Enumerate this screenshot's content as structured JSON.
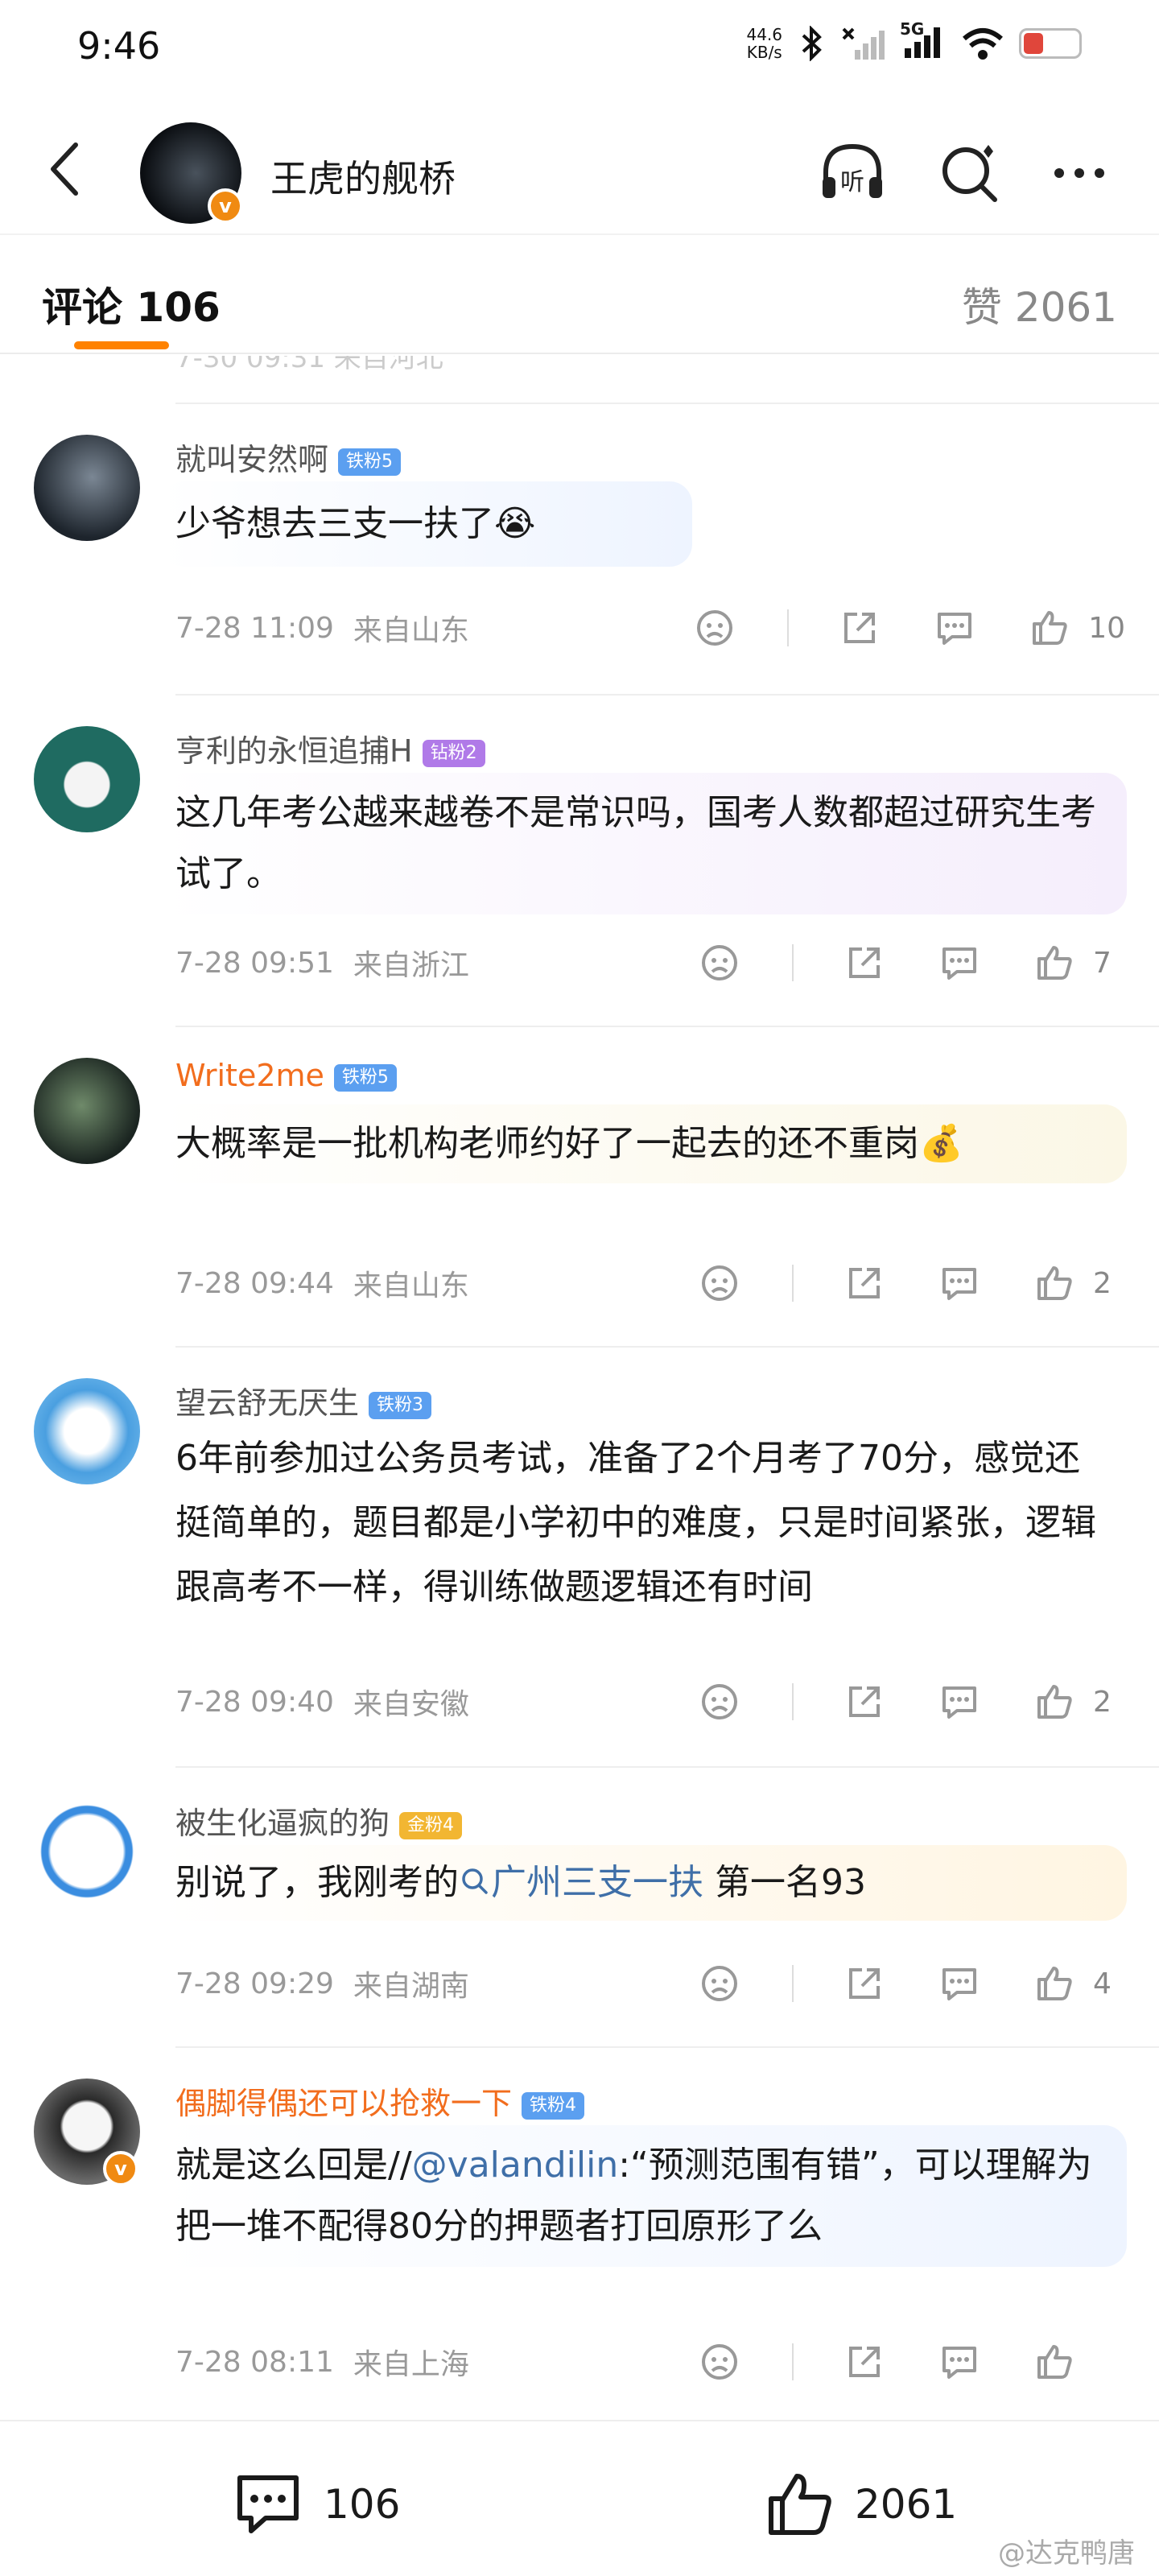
{
  "status_bar": {
    "time": "9:46",
    "net_speed_value": "44.6",
    "net_speed_unit": "KB/s",
    "network": "5G",
    "battery": "7"
  },
  "nav": {
    "title": "王虎的舰桥"
  },
  "tabs": {
    "comments_label": "评论 106",
    "likes_label": "赞 2061"
  },
  "partial_row": {
    "text": "7-30 09:31 来自河北"
  },
  "comments": [
    {
      "name": "就叫安然啊",
      "badge": "铁粉5",
      "badge_color": "#5b9ff0",
      "text": "少爷想去三支一扶了😭",
      "date": "7-28 11:09",
      "location": "来自山东",
      "likes": "10"
    },
    {
      "name": "亨利的永恒追捕H",
      "badge": "钻粉2",
      "badge_color": "#b07ae8",
      "text": "这几年考公越来越卷不是常识吗，国考人数都超过研究生考试了。",
      "date": "7-28 09:51",
      "location": "来自浙江",
      "likes": "7"
    },
    {
      "name": "Write2me",
      "badge": "铁粉5",
      "badge_color": "#5b9ff0",
      "text": "大概率是一批机构老师约好了一起去的还不重岗💰",
      "date": "7-28 09:44",
      "location": "来自山东",
      "likes": "2"
    },
    {
      "name": "望云舒无厌生",
      "badge": "铁粉3",
      "badge_color": "#5b9ff0",
      "text": "6年前参加过公务员考试，准备了2个月考了70分，感觉还挺简单的，题目都是小学初中的难度，只是时间紧张，逻辑跟高考不一样，得训练做题逻辑还有时间",
      "date": "7-28 09:40",
      "location": "来自安徽",
      "likes": "2"
    },
    {
      "name": "被生化逼疯的狗",
      "badge": "金粉4",
      "badge_color": "#f2b632",
      "text_before": "别说了，我刚考的",
      "topic": "广州三支一扶",
      "text_after": " 第一名93",
      "date": "7-28 09:29",
      "location": "来自湖南",
      "likes": "4"
    },
    {
      "name": "偶脚得偶还可以抢救一下",
      "badge": "铁粉4",
      "badge_color": "#5b9ff0",
      "text_before": "就是这么回是//",
      "mention": "@valandilin",
      "text_after": ":“预测范围有错”，可以理解为把一堆不配得80分的押题者打回原形了么",
      "date": "7-28 08:11",
      "location": "来自上海",
      "likes": ""
    }
  ],
  "bottom_bar": {
    "comment_count": "106",
    "like_count": "2061"
  },
  "watermark": "@达克鸭唐",
  "colors": {
    "accent": "#ff8200",
    "orange_name": "#f26d1d",
    "link": "#3f6fa8"
  },
  "icons": [
    "back-icon",
    "listen-icon",
    "search-icon",
    "more-icon",
    "dislike-icon",
    "share-icon",
    "reply-icon",
    "like-icon"
  ]
}
